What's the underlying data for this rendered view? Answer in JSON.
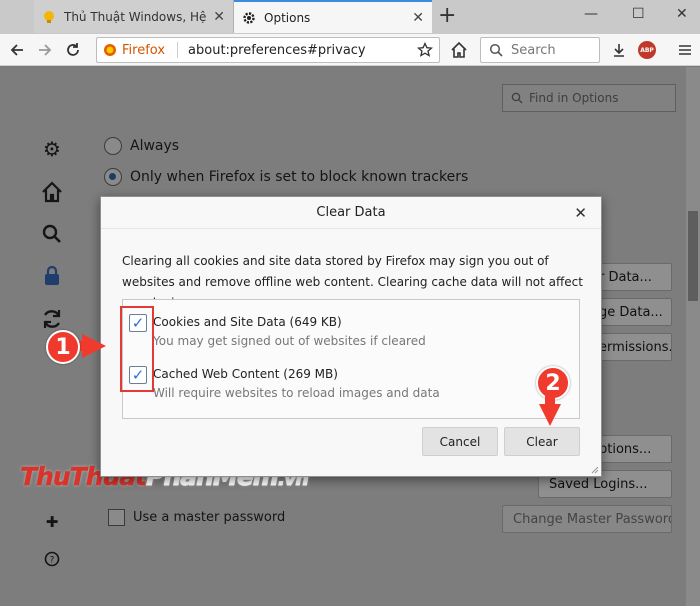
{
  "tabs": [
    {
      "label": "Thủ Thuật Windows, Hệ Điều H",
      "close": "✕"
    },
    {
      "label": "Options",
      "close": "✕"
    }
  ],
  "toolbar": {
    "new_tab": "+",
    "url_brand": "Firefox",
    "url": "about:preferences#privacy",
    "search_placeholder": "Search",
    "abp_label": "ABP",
    "win_min": "—",
    "win_max": "☐",
    "win_close": "✕"
  },
  "page": {
    "find_placeholder": "Find in Options",
    "radio_always": "Always",
    "radio_trackers": "Only when Firefox is set to block known trackers",
    "clear_data_btn": "r Data...",
    "manage_data_btn": "ge Data...",
    "permissions_btn": "ermissions...",
    "exceptions_btn": "ptions...",
    "saved_logins_btn": "Saved Logins...",
    "master_password_label": "Use a master password",
    "change_master_btn": "Change Master Password..."
  },
  "dialog": {
    "title": "Clear Data",
    "close": "✕",
    "description": "Clearing all cookies and site data stored by Firefox may sign you out of websites and remove offline web content. Clearing cache data will not affect your logins.",
    "options": [
      {
        "label": "Cookies and Site Data (649 KB)",
        "sublabel": "You may get signed out of websites if cleared",
        "checked": true
      },
      {
        "label": "Cached Web Content (269 MB)",
        "sublabel": "Will require websites to reload images and data",
        "checked": true
      }
    ],
    "cancel": "Cancel",
    "clear": "Clear"
  },
  "annotations": {
    "step1": "1",
    "step2": "2"
  },
  "watermark": {
    "part1": "Thu",
    "part2": "Thuat",
    "part3": "Phan",
    "part4": "Mem",
    "part5": ".vn"
  },
  "colors": {
    "annotation_red": "#ef3a2d",
    "accent_blue": "#2a6fd6"
  }
}
